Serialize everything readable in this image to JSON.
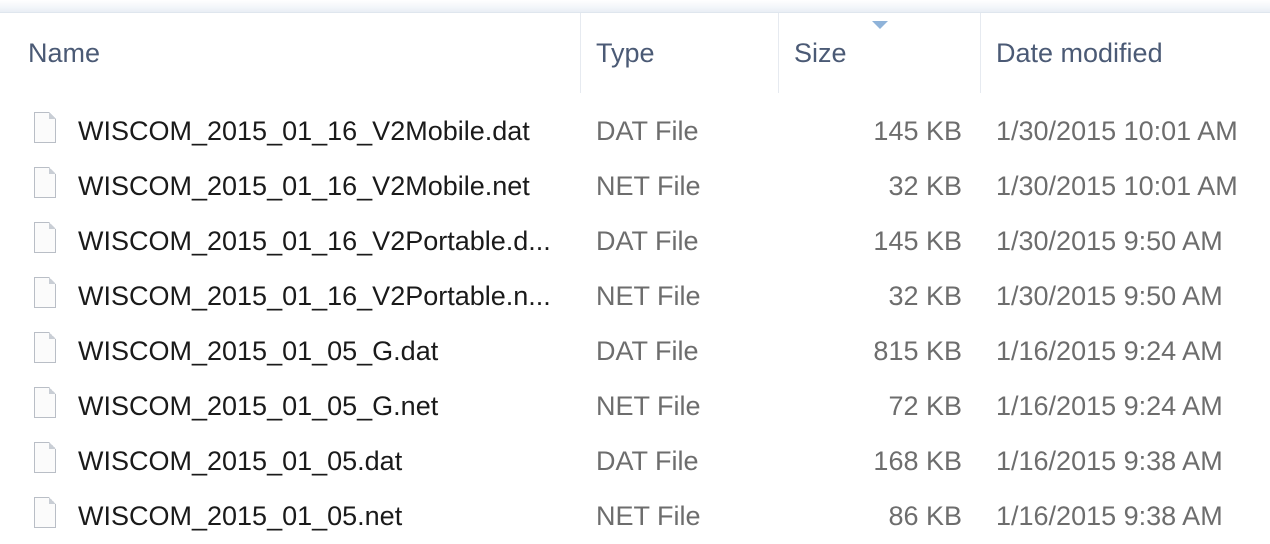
{
  "columns": {
    "name": "Name",
    "type": "Type",
    "size": "Size",
    "date": "Date modified"
  },
  "sort": {
    "column": "size",
    "direction": "descending"
  },
  "files": [
    {
      "name": "WISCOM_2015_01_16_V2Mobile.dat",
      "type": "DAT File",
      "size": "145 KB",
      "date": "1/30/2015 10:01 AM"
    },
    {
      "name": "WISCOM_2015_01_16_V2Mobile.net",
      "type": "NET File",
      "size": "32 KB",
      "date": "1/30/2015 10:01 AM"
    },
    {
      "name": "WISCOM_2015_01_16_V2Portable.d...",
      "type": "DAT File",
      "size": "145 KB",
      "date": "1/30/2015 9:50 AM"
    },
    {
      "name": "WISCOM_2015_01_16_V2Portable.n...",
      "type": "NET File",
      "size": "32 KB",
      "date": "1/30/2015 9:50 AM"
    },
    {
      "name": "WISCOM_2015_01_05_G.dat",
      "type": "DAT File",
      "size": "815 KB",
      "date": "1/16/2015 9:24 AM"
    },
    {
      "name": "WISCOM_2015_01_05_G.net",
      "type": "NET File",
      "size": "72 KB",
      "date": "1/16/2015 9:24 AM"
    },
    {
      "name": "WISCOM_2015_01_05.dat",
      "type": "DAT File",
      "size": "168 KB",
      "date": "1/16/2015 9:38 AM"
    },
    {
      "name": "WISCOM_2015_01_05.net",
      "type": "NET File",
      "size": "86 KB",
      "date": "1/16/2015 9:38 AM"
    }
  ],
  "icons": {
    "file": "file-icon",
    "sort": "sort-arrow-icon"
  },
  "colors": {
    "header_text": "#4b5a75",
    "name_text": "#1a1a1a",
    "detail_text": "#6d6d6d",
    "sort_arrow": "#8fb3d9"
  }
}
